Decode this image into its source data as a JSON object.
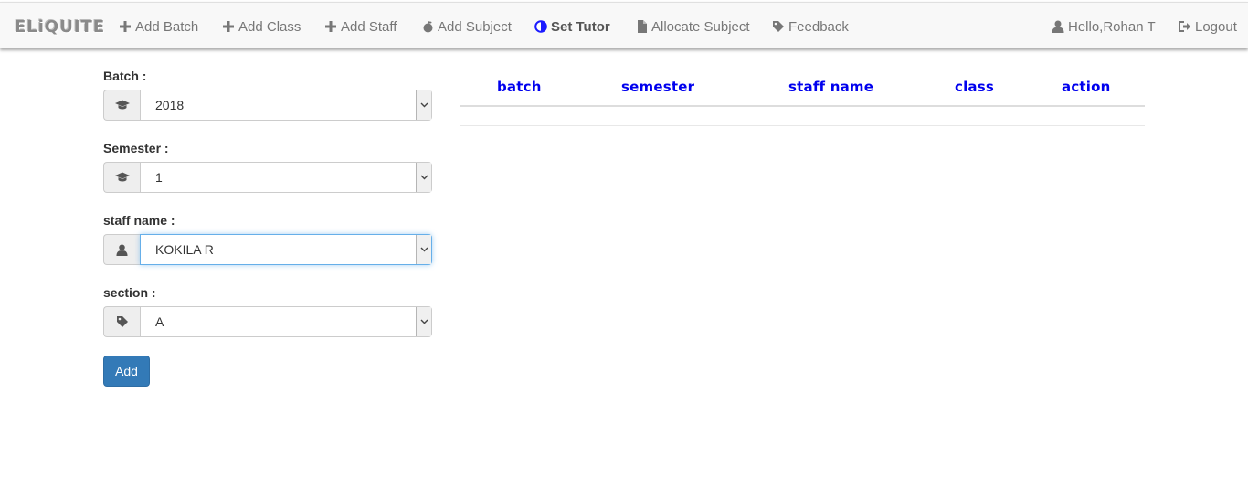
{
  "brand": "ELiQUITE",
  "nav": {
    "add_batch": "Add Batch",
    "add_class": "Add Class",
    "add_staff": "Add Staff",
    "add_subject": "Add Subject",
    "set_tutor": "Set Tutor",
    "allocate_subject": "Allocate Subject",
    "feedback": "Feedback",
    "user": "Hello,Rohan T",
    "logout": "Logout"
  },
  "form": {
    "batch": {
      "label": "Batch :",
      "value": "2018",
      "icon": "graduation-cap-icon"
    },
    "semester": {
      "label": "Semester :",
      "value": "1",
      "icon": "graduation-cap-icon"
    },
    "staff": {
      "label": "staff name :",
      "value": "KOKILA R",
      "icon": "user-icon"
    },
    "section": {
      "label": "section :",
      "value": "A",
      "icon": "tag-icon"
    },
    "add_button": "Add"
  },
  "table": {
    "headers": [
      "batch",
      "semester",
      "staff name",
      "class",
      "action"
    ]
  },
  "colors": {
    "primary": "#337ab7",
    "header_link": "#0000ee",
    "navbar_bg": "#f8f8f8",
    "active_icon": "#1a1aff"
  }
}
